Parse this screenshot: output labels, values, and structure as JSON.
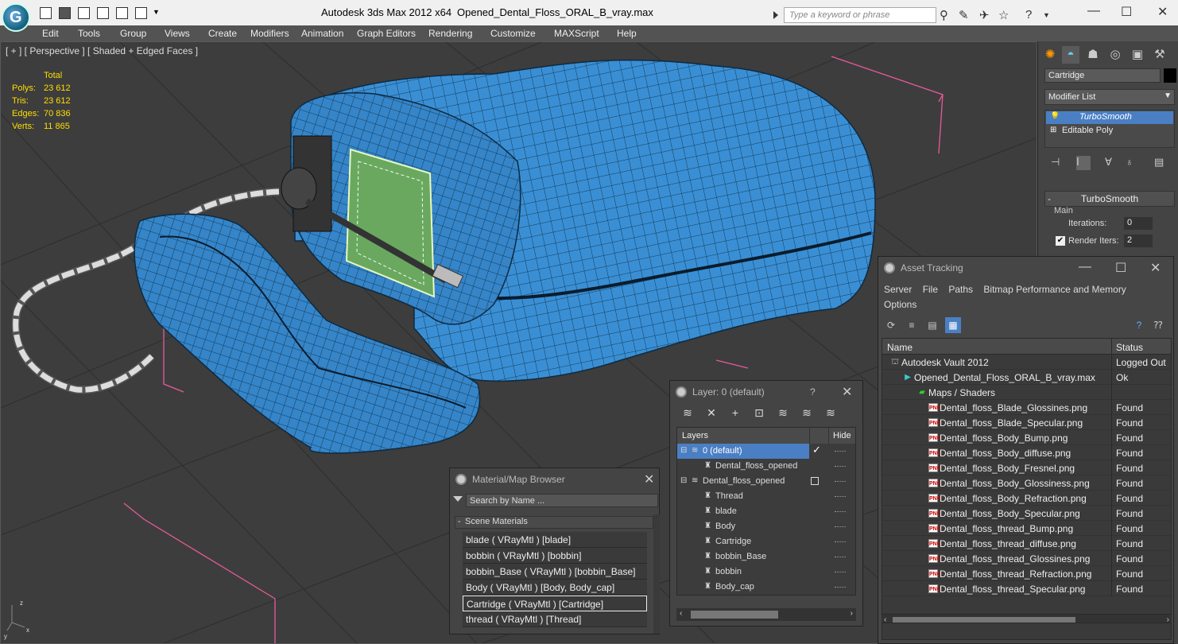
{
  "app": {
    "title": "Autodesk 3ds Max  2012 x64",
    "file": "Opened_Dental_Floss_ORAL_B_vray.max",
    "search_placeholder": "Type a keyword or phrase"
  },
  "menu": [
    "Edit",
    "Tools",
    "Group",
    "Views",
    "Create",
    "Modifiers",
    "Animation",
    "Graph Editors",
    "Rendering",
    "Customize",
    "MAXScript",
    "Help"
  ],
  "viewport": {
    "label": "[ + ] [ Perspective ] [ Shaded + Edged Faces ]",
    "stats_header": "Total",
    "stats": [
      {
        "k": "Polys:",
        "v": "23 612"
      },
      {
        "k": "Tris:",
        "v": "23 612"
      },
      {
        "k": "Edges:",
        "v": "70 836"
      },
      {
        "k": "Verts:",
        "v": "11 865"
      }
    ],
    "axis": {
      "z": "z",
      "x": "x",
      "y": "y"
    }
  },
  "command_panel": {
    "object_name": "Cartridge",
    "modifier_list": "Modifier List",
    "stack": [
      "TurboSmooth",
      "Editable Poly"
    ],
    "rollout_title": "TurboSmooth",
    "group_main": "Main",
    "iterations_label": "Iterations:",
    "iterations_value": "0",
    "render_iters_label": "Render Iters:",
    "render_iters_value": "2",
    "render_iters_checked": "✔"
  },
  "material_browser": {
    "title": "Material/Map Browser",
    "search_placeholder": "Search by Name ...",
    "section": "Scene Materials",
    "rows": [
      "blade  ( VRayMtl ) [blade]",
      "bobbin  ( VRayMtl ) [bobbin]",
      "bobbin_Base  ( VRayMtl ) [bobbin_Base]",
      "Body  ( VRayMtl ) [Body, Body_cap]",
      "Cartridge  ( VRayMtl ) [Cartridge]",
      "thread  ( VRayMtl ) [Thread]"
    ]
  },
  "layer_window": {
    "title": "Layer: 0 (default)",
    "help": "?",
    "col_layers": "Layers",
    "col_hide": "Hide",
    "rows": [
      {
        "name": "0 (default)",
        "level": 0
      },
      {
        "name": "Dental_floss_opened",
        "level": 1
      },
      {
        "name": "Dental_floss_opened",
        "level": 0
      },
      {
        "name": "Thread",
        "level": 1
      },
      {
        "name": "blade",
        "level": 1
      },
      {
        "name": "Body",
        "level": 1
      },
      {
        "name": "Cartridge",
        "level": 1
      },
      {
        "name": "bobbin_Base",
        "level": 1
      },
      {
        "name": "bobbin",
        "level": 1
      },
      {
        "name": "Body_cap",
        "level": 1
      }
    ]
  },
  "asset_tracking": {
    "title": "Asset Tracking",
    "menu": [
      "Server",
      "File",
      "Paths",
      "Bitmap Performance and Memory",
      "Options"
    ],
    "col_name": "Name",
    "col_status": "Status",
    "rows": [
      {
        "name": "Autodesk Vault 2012",
        "status": "Logged Out",
        "level": 0
      },
      {
        "name": "Opened_Dental_Floss_ORAL_B_vray.max",
        "status": "Ok",
        "level": 1
      },
      {
        "name": "Maps / Shaders",
        "status": "",
        "level": 2
      },
      {
        "name": "Dental_floss_Blade_Glossines.png",
        "status": "Found",
        "level": 3
      },
      {
        "name": "Dental_floss_Blade_Specular.png",
        "status": "Found",
        "level": 3
      },
      {
        "name": "Dental_floss_Body_Bump.png",
        "status": "Found",
        "level": 3
      },
      {
        "name": "Dental_floss_Body_diffuse.png",
        "status": "Found",
        "level": 3
      },
      {
        "name": "Dental_floss_Body_Fresnel.png",
        "status": "Found",
        "level": 3
      },
      {
        "name": "Dental_floss_Body_Glossiness.png",
        "status": "Found",
        "level": 3
      },
      {
        "name": "Dental_floss_Body_Refraction.png",
        "status": "Found",
        "level": 3
      },
      {
        "name": "Dental_floss_Body_Specular.png",
        "status": "Found",
        "level": 3
      },
      {
        "name": "Dental_floss_thread_Bump.png",
        "status": "Found",
        "level": 3
      },
      {
        "name": "Dental_floss_thread_diffuse.png",
        "status": "Found",
        "level": 3
      },
      {
        "name": "Dental_floss_thread_Glossines.png",
        "status": "Found",
        "level": 3
      },
      {
        "name": "Dental_floss_thread_Refraction.png",
        "status": "Found",
        "level": 3
      },
      {
        "name": "Dental_floss_thread_Specular.png",
        "status": "Found",
        "level": 3
      }
    ]
  },
  "colors": {
    "model_blue": "#3a8fd4",
    "selection_blue": "#4a7fc4",
    "stats_yellow": "#ffde00",
    "bbox_pink": "#e85a9a"
  }
}
